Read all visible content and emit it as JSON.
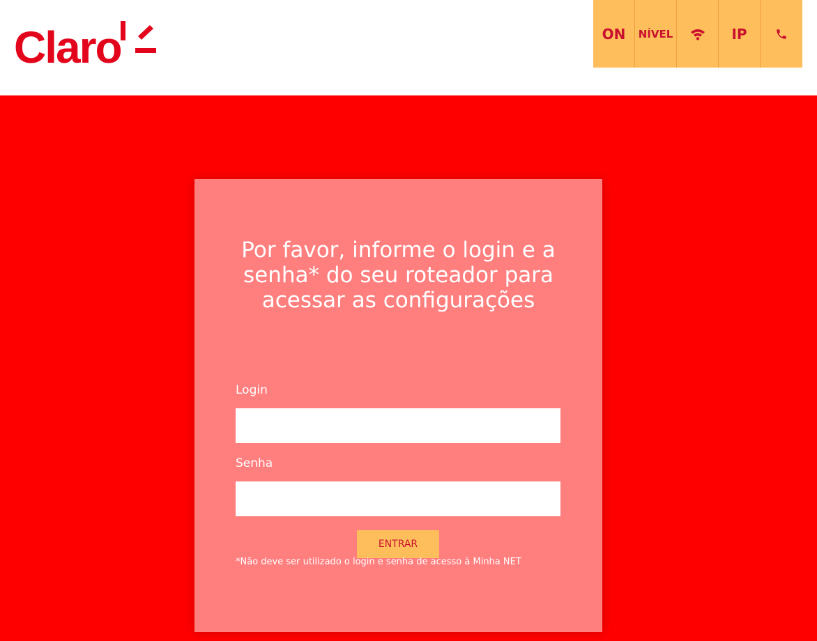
{
  "brand": {
    "logo_text": "Claro",
    "color": "#e3051b"
  },
  "status_bar": {
    "items": [
      {
        "label": "ON",
        "icon": ""
      },
      {
        "label": "NÍVEL",
        "icon": ""
      },
      {
        "label": "",
        "icon": "wifi-icon"
      },
      {
        "label": "IP",
        "icon": ""
      },
      {
        "label": "",
        "icon": "phone-icon"
      }
    ],
    "background": "#ffbe5c",
    "text_color": "#c8102e"
  },
  "login_form": {
    "title": "Por favor, informe o login e a senha* do seu roteador para acessar as configurações",
    "login_label": "Login",
    "login_value": "",
    "password_label": "Senha",
    "password_value": "",
    "submit_label": "ENTRAR",
    "disclaimer": "*Não deve ser utilizado o login e senha de acesso à Minha NET"
  },
  "colors": {
    "page_background": "#ff0000",
    "card_background": "#ff7e7e",
    "button_background": "#ffbe5c"
  }
}
